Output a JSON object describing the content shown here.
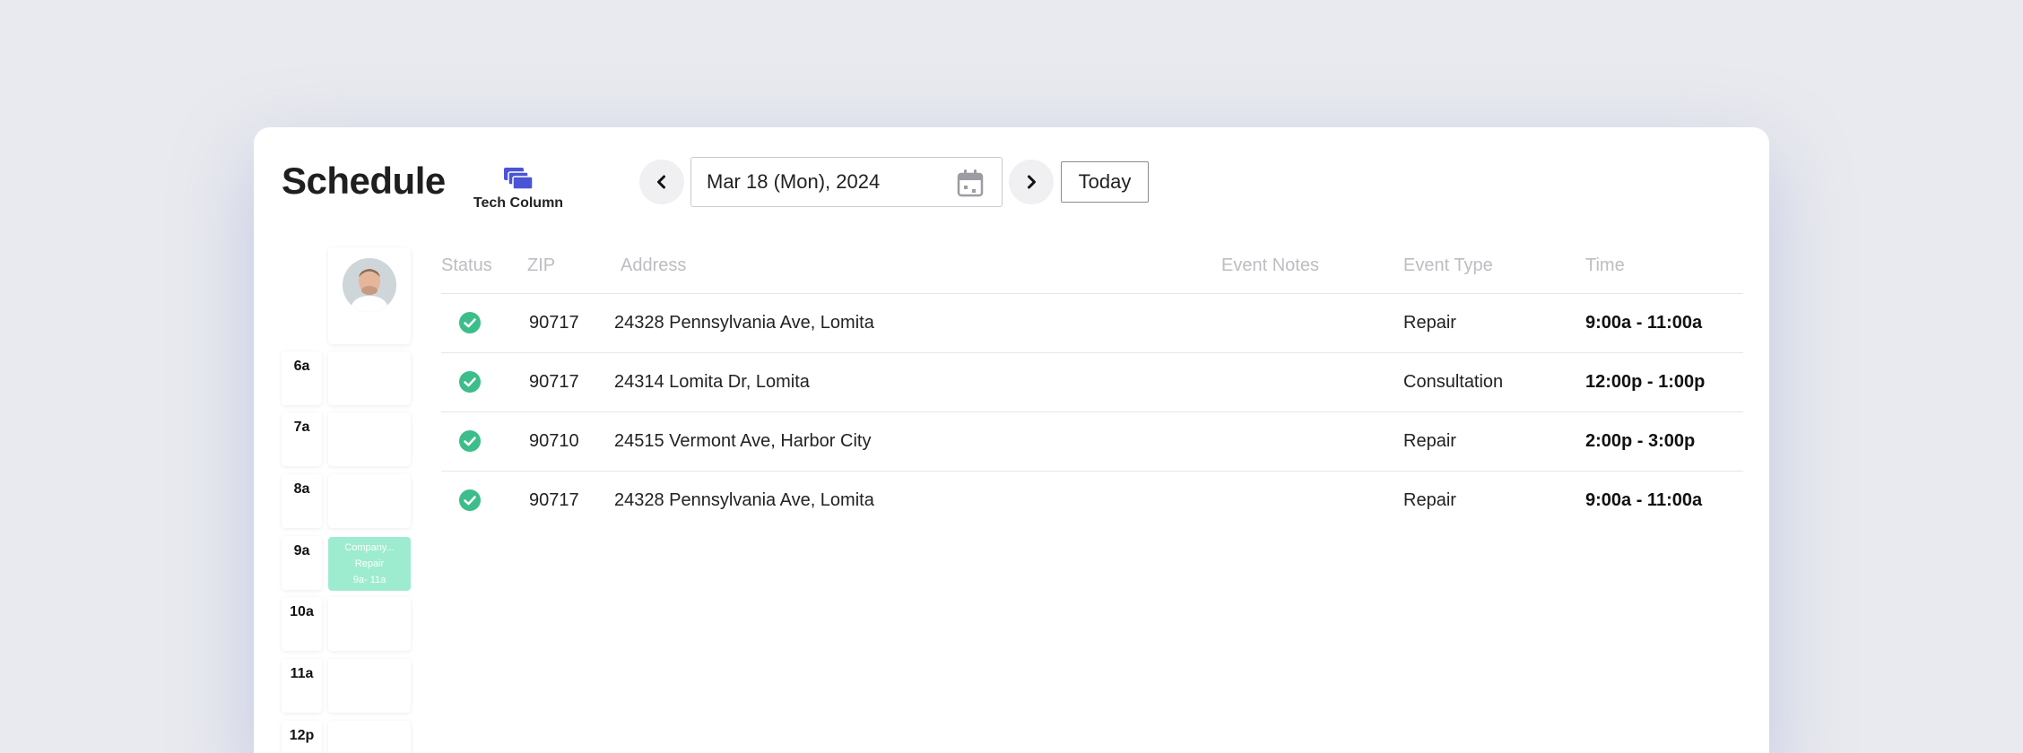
{
  "header": {
    "title": "Schedule",
    "tech_column_label": "Tech Column",
    "date_value": "Mar 18 (Mon), 2024",
    "today_label": "Today"
  },
  "time_column": {
    "hours": [
      "6a",
      "7a",
      "8a",
      "9a",
      "10a",
      "11a",
      "12p"
    ],
    "event": {
      "company": "Company...",
      "type": "Repair",
      "time": "9a- 11a",
      "color": "#9deccf"
    }
  },
  "table": {
    "headers": {
      "status": "Status",
      "zip": "ZIP",
      "address": "Address",
      "notes": "Event Notes",
      "type": "Event Type",
      "time": "Time"
    },
    "rows": [
      {
        "zip": "90717",
        "address": "24328 Pennsylvania Ave, Lomita",
        "notes": "",
        "type": "Repair",
        "time": "9:00a - 11:00a"
      },
      {
        "zip": "90717",
        "address": "24314 Lomita Dr, Lomita",
        "notes": "",
        "type": "Consultation",
        "time": "12:00p - 1:00p"
      },
      {
        "zip": "90710",
        "address": "24515 Vermont Ave, Harbor City",
        "notes": "",
        "type": "Repair",
        "time": "2:00p - 3:00p"
      },
      {
        "zip": "90717",
        "address": "24328 Pennsylvania Ave, Lomita",
        "notes": "",
        "type": "Repair",
        "time": "9:00a - 11:00a"
      }
    ]
  },
  "colors": {
    "accent": "#4a54d6",
    "status_ok": "#3dbd8a",
    "header_text": "#bdbdc2"
  }
}
